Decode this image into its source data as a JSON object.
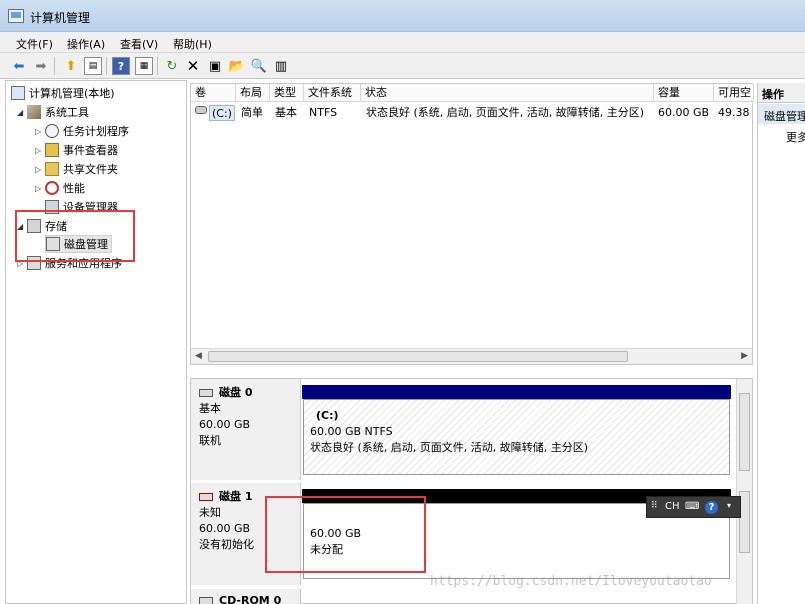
{
  "window": {
    "title": "计算机管理"
  },
  "menu": {
    "file": "文件(F)",
    "action": "操作(A)",
    "view": "查看(V)",
    "help": "帮助(H)"
  },
  "tree": {
    "root": "计算机管理(本地)",
    "system_tools": "系统工具",
    "task_scheduler": "任务计划程序",
    "event_viewer": "事件查看器",
    "shared_folders": "共享文件夹",
    "performance": "性能",
    "device_manager": "设备管理器",
    "storage": "存储",
    "disk_management": "磁盘管理",
    "services_apps": "服务和应用程序"
  },
  "volume_list": {
    "headers": [
      "卷",
      "布局",
      "类型",
      "文件系统",
      "状态",
      "容量",
      "可用空"
    ],
    "row": {
      "volume": "(C:)",
      "layout": "简单",
      "type": "基本",
      "fs": "NTFS",
      "status": "状态良好 (系统, 启动, 页面文件, 活动, 故障转储, 主分区)",
      "capacity": "60.00 GB",
      "free": "49.38"
    }
  },
  "disks": [
    {
      "name": "磁盘 0",
      "type": "基本",
      "size": "60.00 GB",
      "state": "联机",
      "partition": {
        "label": "(C:)",
        "size_fs": "60.00 GB NTFS",
        "status": "状态良好 (系统, 启动, 页面文件, 活动, 故障转储, 主分区)"
      }
    },
    {
      "name": "磁盘 1",
      "type": "未知",
      "size": "60.00 GB",
      "state": "没有初始化",
      "partition": {
        "size": "60.00 GB",
        "status": "未分配"
      }
    },
    {
      "name": "CD-ROM 0"
    }
  ],
  "actions": {
    "header": "操作",
    "item": "磁盘管理",
    "more": "更多"
  },
  "langbar": {
    "lang": "CH"
  },
  "watermark": "https://blog.csdn.net/Iloveyoutaotao",
  "colors": {
    "primary_partition": "#00007f",
    "unallocated": "#000000",
    "highlight": "#e03c3c"
  }
}
